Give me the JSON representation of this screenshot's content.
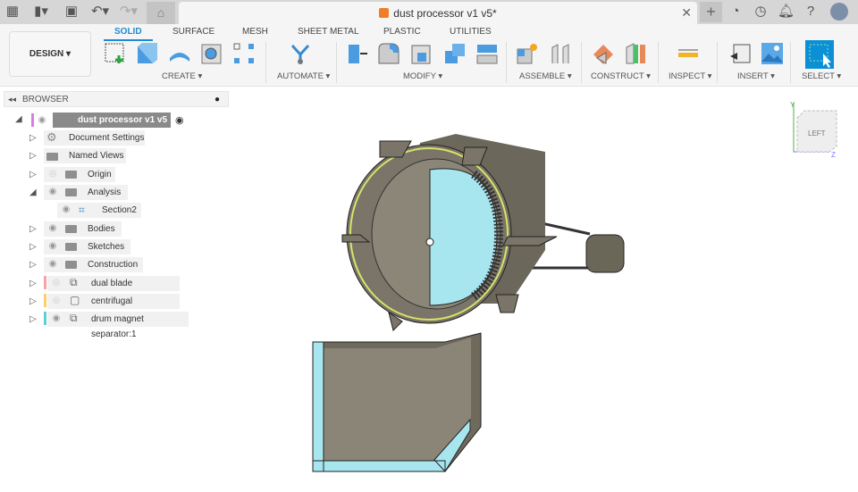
{
  "titlebar": {
    "document_title": "dust processor v1 v5*",
    "icons": [
      "apps-grid-icon",
      "file-icon",
      "save-icon",
      "undo-icon",
      "redo-icon",
      "home-icon",
      "close-icon",
      "new-tab-icon",
      "extensions-icon",
      "job-status-icon",
      "notifications-icon",
      "help-icon",
      "user-avatar"
    ]
  },
  "toolbar": {
    "workspace": "DESIGN",
    "tabs": [
      {
        "label": "SOLID",
        "active": true
      },
      {
        "label": "SURFACE"
      },
      {
        "label": "MESH"
      },
      {
        "label": "SHEET METAL"
      },
      {
        "label": "PLASTIC"
      },
      {
        "label": "UTILITIES"
      }
    ],
    "groups": [
      {
        "label": "CREATE ▾"
      },
      {
        "label": "AUTOMATE ▾"
      },
      {
        "label": "MODIFY ▾"
      },
      {
        "label": "ASSEMBLE ▾"
      },
      {
        "label": "CONSTRUCT ▾"
      },
      {
        "label": "INSPECT ▾"
      },
      {
        "label": "INSERT ▾"
      },
      {
        "label": "SELECT ▾"
      }
    ]
  },
  "browser": {
    "title": "BROWSER",
    "root": "dust processor v1 v5",
    "items": [
      {
        "label": "Document Settings",
        "icon": "gear-icon"
      },
      {
        "label": "Named Views",
        "icon": "folder-icon"
      },
      {
        "label": "Origin",
        "icon": "folder-icon",
        "visible": false
      },
      {
        "label": "Analysis",
        "icon": "folder-icon",
        "expanded": true
      },
      {
        "label": "Section2",
        "icon": "section-icon"
      },
      {
        "label": "Bodies",
        "icon": "folder-icon"
      },
      {
        "label": "Sketches",
        "icon": "folder-icon"
      },
      {
        "label": "Construction",
        "icon": "folder-icon"
      },
      {
        "label": "dual blade seperator:1",
        "color": "#f7a1a8",
        "visible": false
      },
      {
        "label": "centrifugal seperator:1",
        "color": "#f9cf6b",
        "visible": false
      },
      {
        "label": "drum magnet separator:1",
        "color": "#5fd0d0"
      }
    ]
  },
  "viewcube": {
    "face": "LEFT",
    "axes": [
      "Y",
      "Z"
    ]
  },
  "colors": {
    "accent": "#1c8ad6",
    "section_fill": "#a8e6ef",
    "body": "#7a7568"
  }
}
